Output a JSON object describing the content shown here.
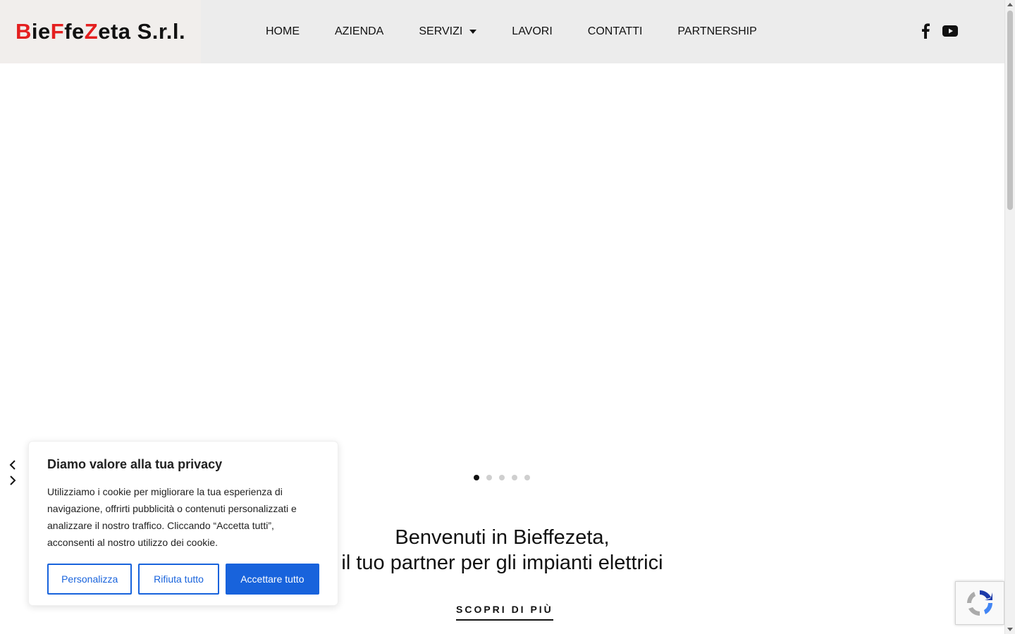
{
  "header": {
    "logo": {
      "parts": [
        "B",
        "ie",
        "F",
        "fe",
        "Z",
        "eta S.r.l."
      ]
    },
    "nav": {
      "home": "HOME",
      "azienda": "AZIENDA",
      "servizi": "SERVIZI",
      "lavori": "LAVORI",
      "contatti": "CONTATTI",
      "partnership": "PARTNERSHIP"
    },
    "social_icons": [
      "facebook-icon",
      "youtube-icon"
    ]
  },
  "slider": {
    "slide_count": 5,
    "active_slide": 1
  },
  "hero": {
    "line1": "Benvenuti in Bieffezeta,",
    "line2": "il tuo partner per gli impianti elettrici",
    "cta": "SCOPRI DI PIÙ"
  },
  "cookie_banner": {
    "title": "Diamo valore alla tua privacy",
    "text": "Utilizziamo i cookie per migliorare la tua esperienza di navigazione, offrirti pubblicità o contenuti personalizzati e analizzare il nostro traffico. Cliccando “Accetta tutti”, acconsenti al nostro utilizzo dei cookie.",
    "customize": "Personalizza",
    "reject": "Rifiuta tutto",
    "accept": "Accettare tutto"
  },
  "colors": {
    "logo_accent": "#e41f1f",
    "header_bg": "#ececec",
    "button_blue": "#1863dc"
  }
}
